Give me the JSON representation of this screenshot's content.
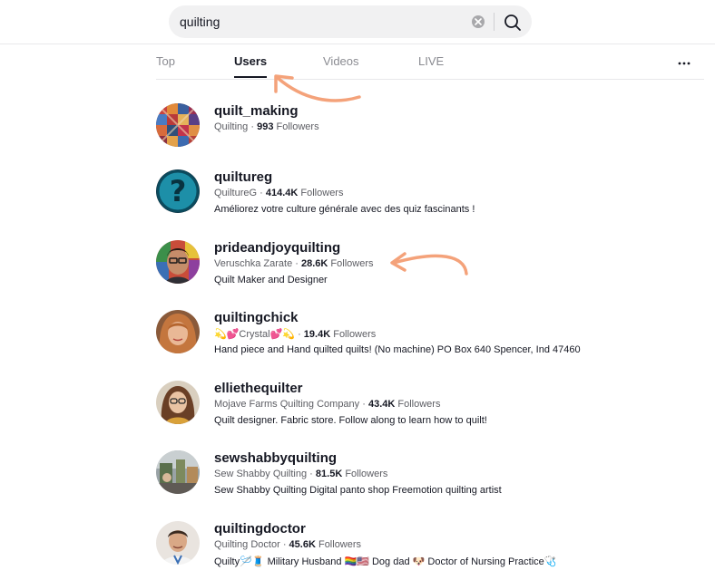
{
  "search": {
    "value": "quilting"
  },
  "tabs": [
    {
      "label": "Top"
    },
    {
      "label": "Users"
    },
    {
      "label": "Videos"
    },
    {
      "label": "LIVE"
    }
  ],
  "colors": {
    "annotation_arrow": "#f4a27a",
    "text_primary": "#161823",
    "text_secondary": "#5c5d63"
  },
  "users": [
    {
      "username": "quilt_making",
      "nickname": "Quilting",
      "followers": "993",
      "followers_label": "Followers",
      "bio": ""
    },
    {
      "username": "quiltureg",
      "nickname": "QuiltureG",
      "followers": "414.4K",
      "followers_label": "Followers",
      "bio": "Améliorez votre culture générale avec des quiz fascinants !"
    },
    {
      "username": "prideandjoyquilting",
      "nickname": "Veruschka Zarate",
      "followers": "28.6K",
      "followers_label": "Followers",
      "bio": "Quilt Maker and Designer"
    },
    {
      "username": "quiltingchick",
      "nickname": "💫💕Crystal💕💫",
      "followers": "19.4K",
      "followers_label": "Followers",
      "bio": "Hand piece and Hand quilted quilts! (No machine) PO Box 640 Spencer, Ind 47460"
    },
    {
      "username": "elliethequilter",
      "nickname": "Mojave Farms Quilting Company",
      "followers": "43.4K",
      "followers_label": "Followers",
      "bio": "Quilt designer. Fabric store. Follow along to learn how to quilt!"
    },
    {
      "username": "sewshabbyquilting",
      "nickname": "Sew Shabby Quilting",
      "followers": "81.5K",
      "followers_label": "Followers",
      "bio": "Sew Shabby Quilting Digital panto shop Freemotion quilting artist"
    },
    {
      "username": "quiltingdoctor",
      "nickname": "Quilting Doctor",
      "followers": "45.6K",
      "followers_label": "Followers",
      "bio": "Quilty🪡🧵 Military Husband 🏳️‍🌈🇺🇸 Dog dad 🐶 Doctor of Nursing Practice🩺"
    }
  ]
}
